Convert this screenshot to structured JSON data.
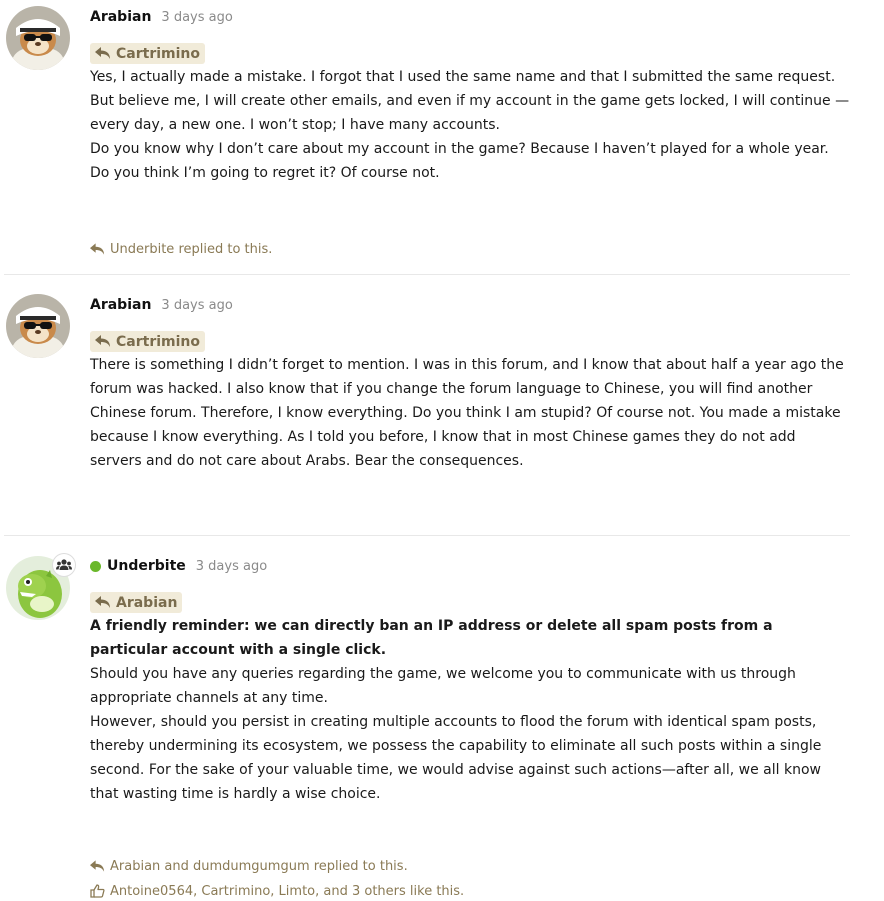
{
  "posts": [
    {
      "author": "Arabian",
      "time": "3 days ago",
      "reply_to": "Cartrimino",
      "paragraphs": [
        "Yes, I actually made a mistake. I forgot that I used the same name and that I submitted the same request. But believe me, I will create other emails, and even if my account in the game gets locked, I will continue — every day, a new one. I won’t stop; I have many accounts.",
        "Do you know why I don’t care about my account in the game? Because I haven’t played for a whole year. Do you think I’m going to regret it? Of course not."
      ],
      "replied_by": "Underbite replied to this."
    },
    {
      "author": "Arabian",
      "time": "3 days ago",
      "reply_to": "Cartrimino",
      "paragraphs": [
        "There is something I didn’t forget to mention. I was in this forum, and I know that about half a year ago the forum was hacked. I also know that if you change the forum language to Chinese, you will find another Chinese forum. Therefore, I know everything. Do you think I am stupid? Of course not. You made a mistake because I know everything. As I told you before, I know that in most Chinese games they do not add servers and do not care about Arabs. Bear the consequences."
      ]
    },
    {
      "author": "Underbite",
      "time": "3 days ago",
      "reply_to": "Arabian",
      "online": true,
      "bold_paragraph": "A friendly reminder: we can directly ban an IP address or delete all spam posts from a particular account with a single click.",
      "paragraphs": [
        "Should you have any queries regarding the game, we welcome you to communicate with us through appropriate channels at any time.",
        "However, should you persist in creating multiple accounts to flood the forum with identical spam posts, thereby undermining its ecosystem, we possess the capability to eliminate all such posts within a single second. For the sake of your valuable time, we would advise against such actions—after all, we all know that wasting time is hardly a wise choice."
      ],
      "replied_by": "Arabian and dumdumgumgum replied to this.",
      "liked_by": "Antoine0564, Cartrimino, Limto, and 3 others like this."
    }
  ],
  "colors": {
    "reply_tag_bg": "#f1ebd9",
    "reply_tag_text": "#7a6c4d",
    "footer_text": "#8a7a55",
    "online": "#6ab82a"
  },
  "icons": {
    "reply": "reply-arrow-icon",
    "like": "thumbs-up-icon",
    "group": "group-icon"
  }
}
